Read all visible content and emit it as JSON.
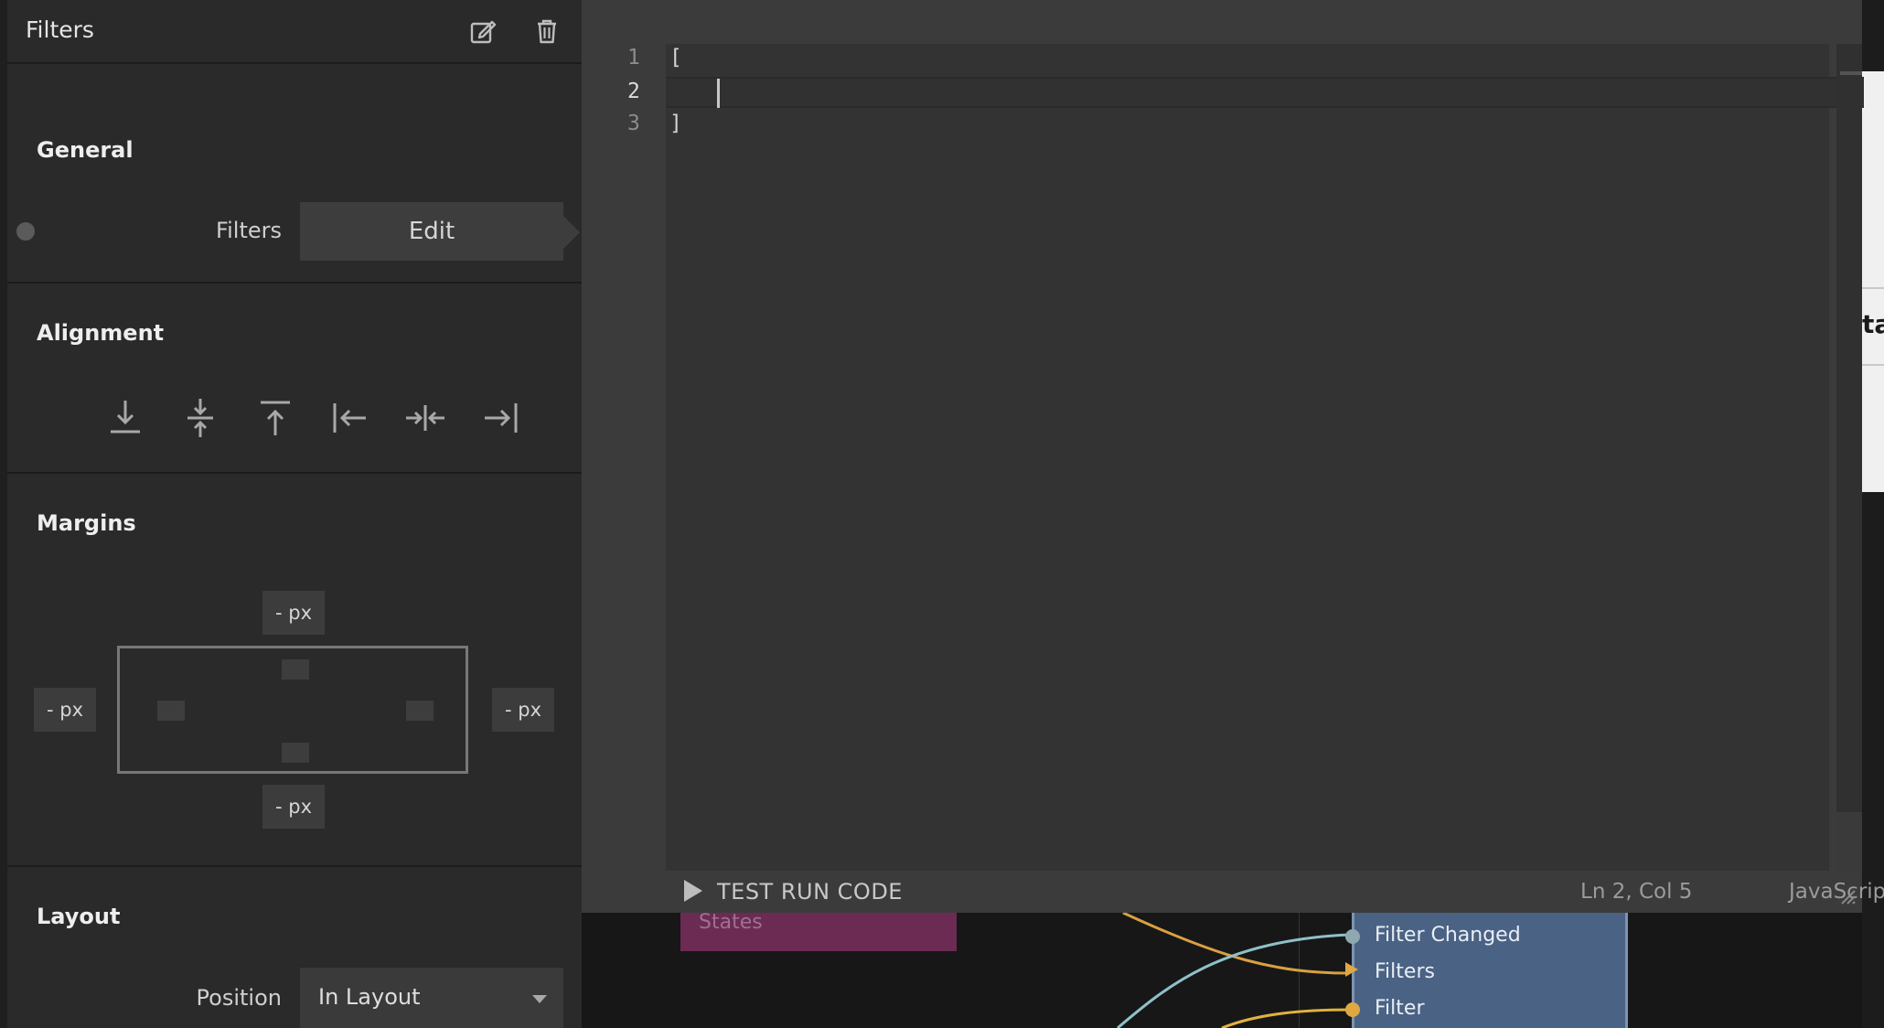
{
  "panel": {
    "title": "Filters",
    "icons": {
      "edit": "edit-icon",
      "delete": "trash-icon"
    },
    "sections": {
      "general": "General",
      "alignment": "Alignment",
      "margins": "Margins",
      "layout": "Layout"
    },
    "filters_label": "Filters",
    "edit_button": "Edit",
    "alignment_icons": [
      "align-bottom-icon",
      "align-vertical-center-icon",
      "align-top-icon",
      "align-left-icon",
      "align-horizontal-center-icon",
      "align-right-icon"
    ],
    "margins": {
      "top": "- px",
      "left": "- px",
      "right": "- px",
      "bottom": "- px"
    },
    "position_label": "Position",
    "position_value": "In Layout"
  },
  "editor": {
    "line_numbers": [
      "1",
      "2",
      "3"
    ],
    "lines": [
      "[",
      "    ",
      "]"
    ],
    "run_button": "TEST RUN CODE",
    "cursor_position": "Ln 2, Col 5",
    "language": "JavaScript"
  },
  "graph": {
    "states_node": "States",
    "ports": [
      "Filter Changed",
      "Filters",
      "Filter"
    ],
    "port_colors": [
      "#8fa8b0",
      "#e0a843",
      "#e0a843"
    ]
  },
  "right_clip_text": "ta"
}
